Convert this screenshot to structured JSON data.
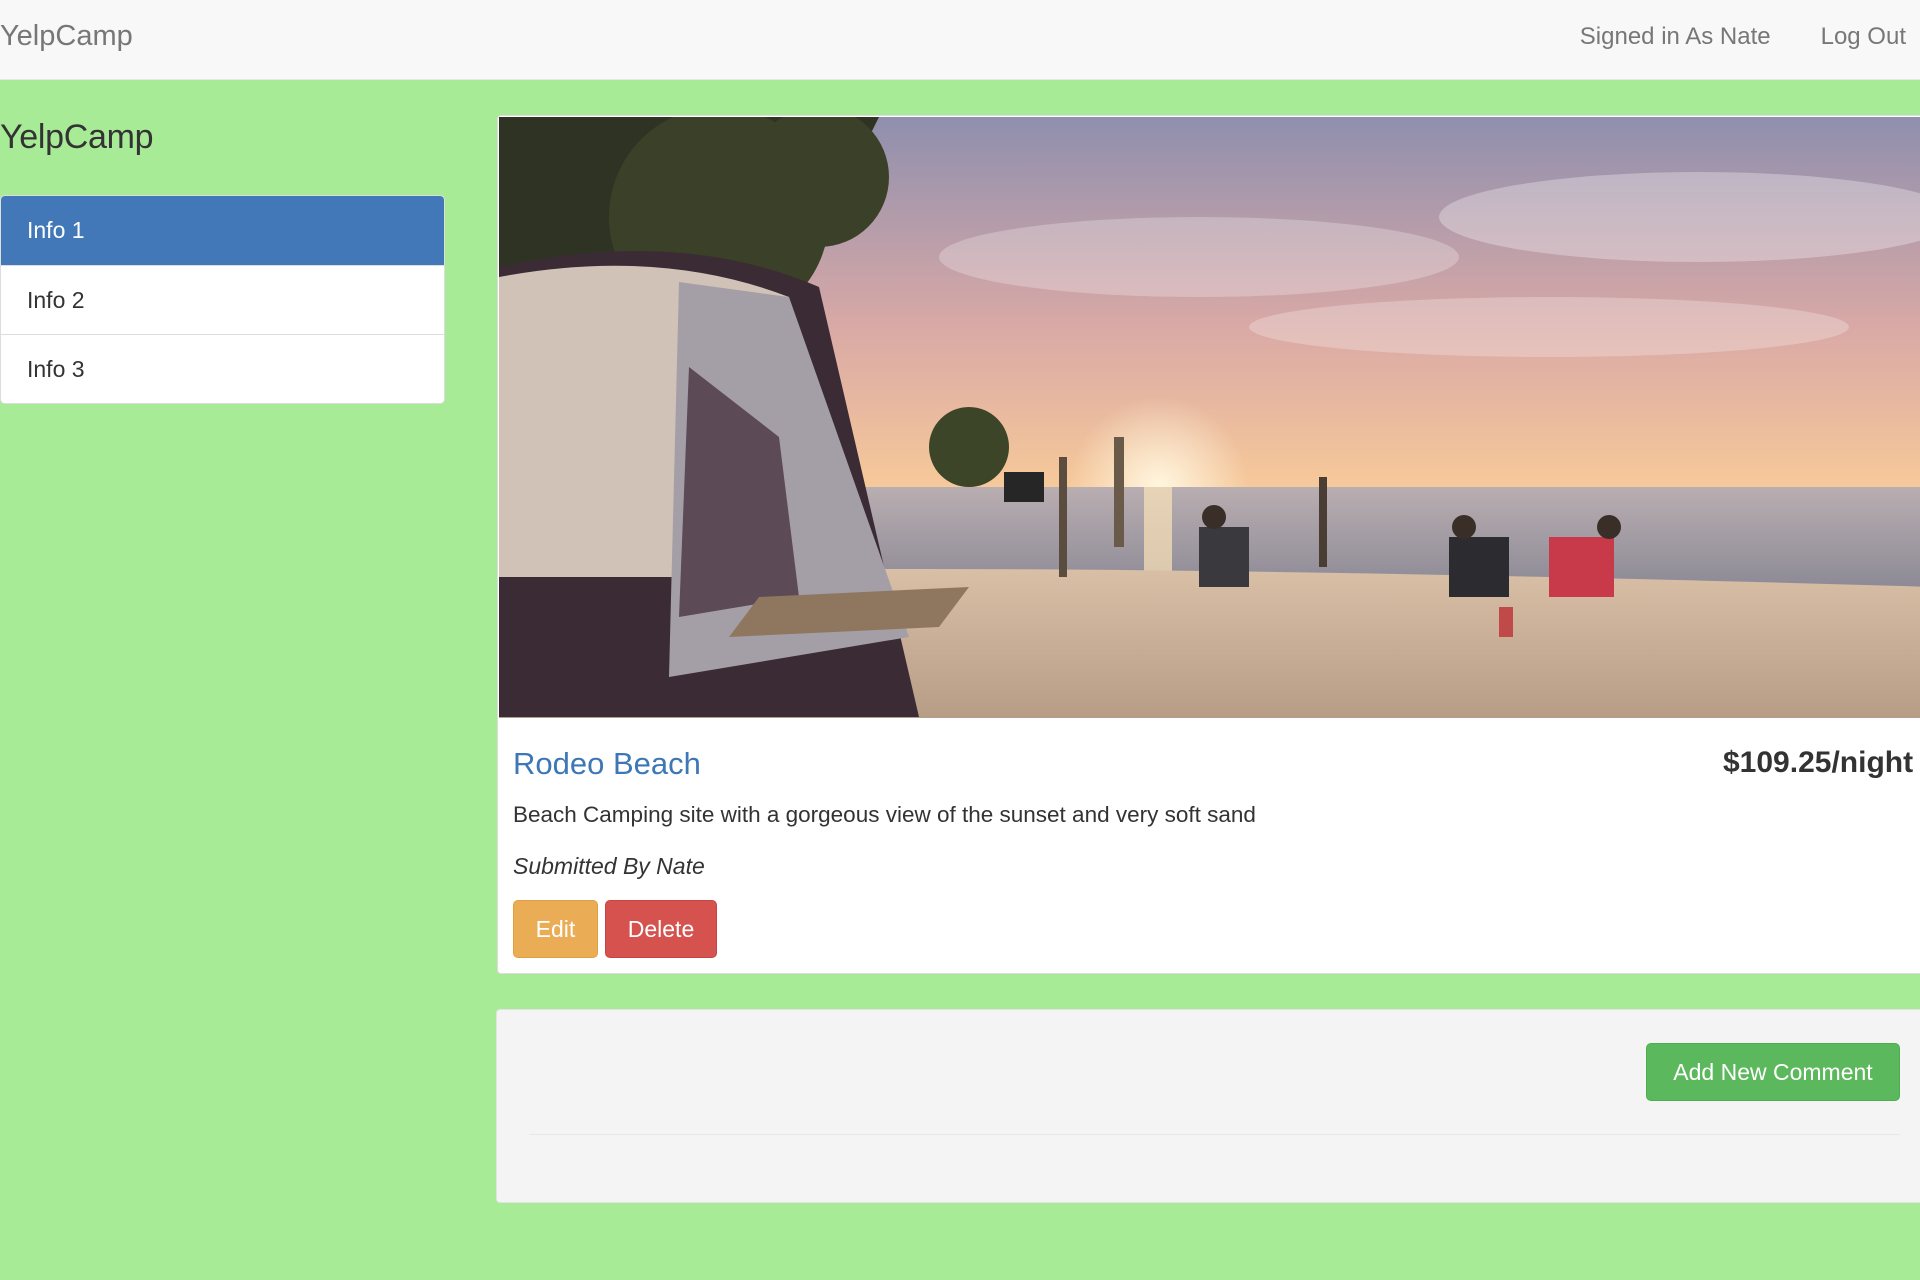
{
  "navbar": {
    "brand": "YelpCamp",
    "signed_in": "Signed in As Nate",
    "logout": "Log Out"
  },
  "sidebar": {
    "lead": "YelpCamp",
    "items": [
      {
        "label": "Info 1",
        "active": true
      },
      {
        "label": "Info 2",
        "active": false
      },
      {
        "label": "Info 3",
        "active": false
      }
    ]
  },
  "campground": {
    "image_alt": "Beach campsite with tent at sunset",
    "name": "Rodeo Beach",
    "price": "$109.25/night",
    "description": "Beach Camping site with a gorgeous view of the sunset and very soft sand",
    "author": "Submitted By Nate",
    "edit_label": "Edit",
    "delete_label": "Delete"
  },
  "comments": {
    "add_label": "Add New Comment"
  },
  "colors": {
    "background": "#a8eb97",
    "active_item": "#4278b8",
    "title_link": "#3d77b6",
    "edit": "#eaad55",
    "delete": "#d6524f",
    "add_comment": "#5cb85c"
  }
}
